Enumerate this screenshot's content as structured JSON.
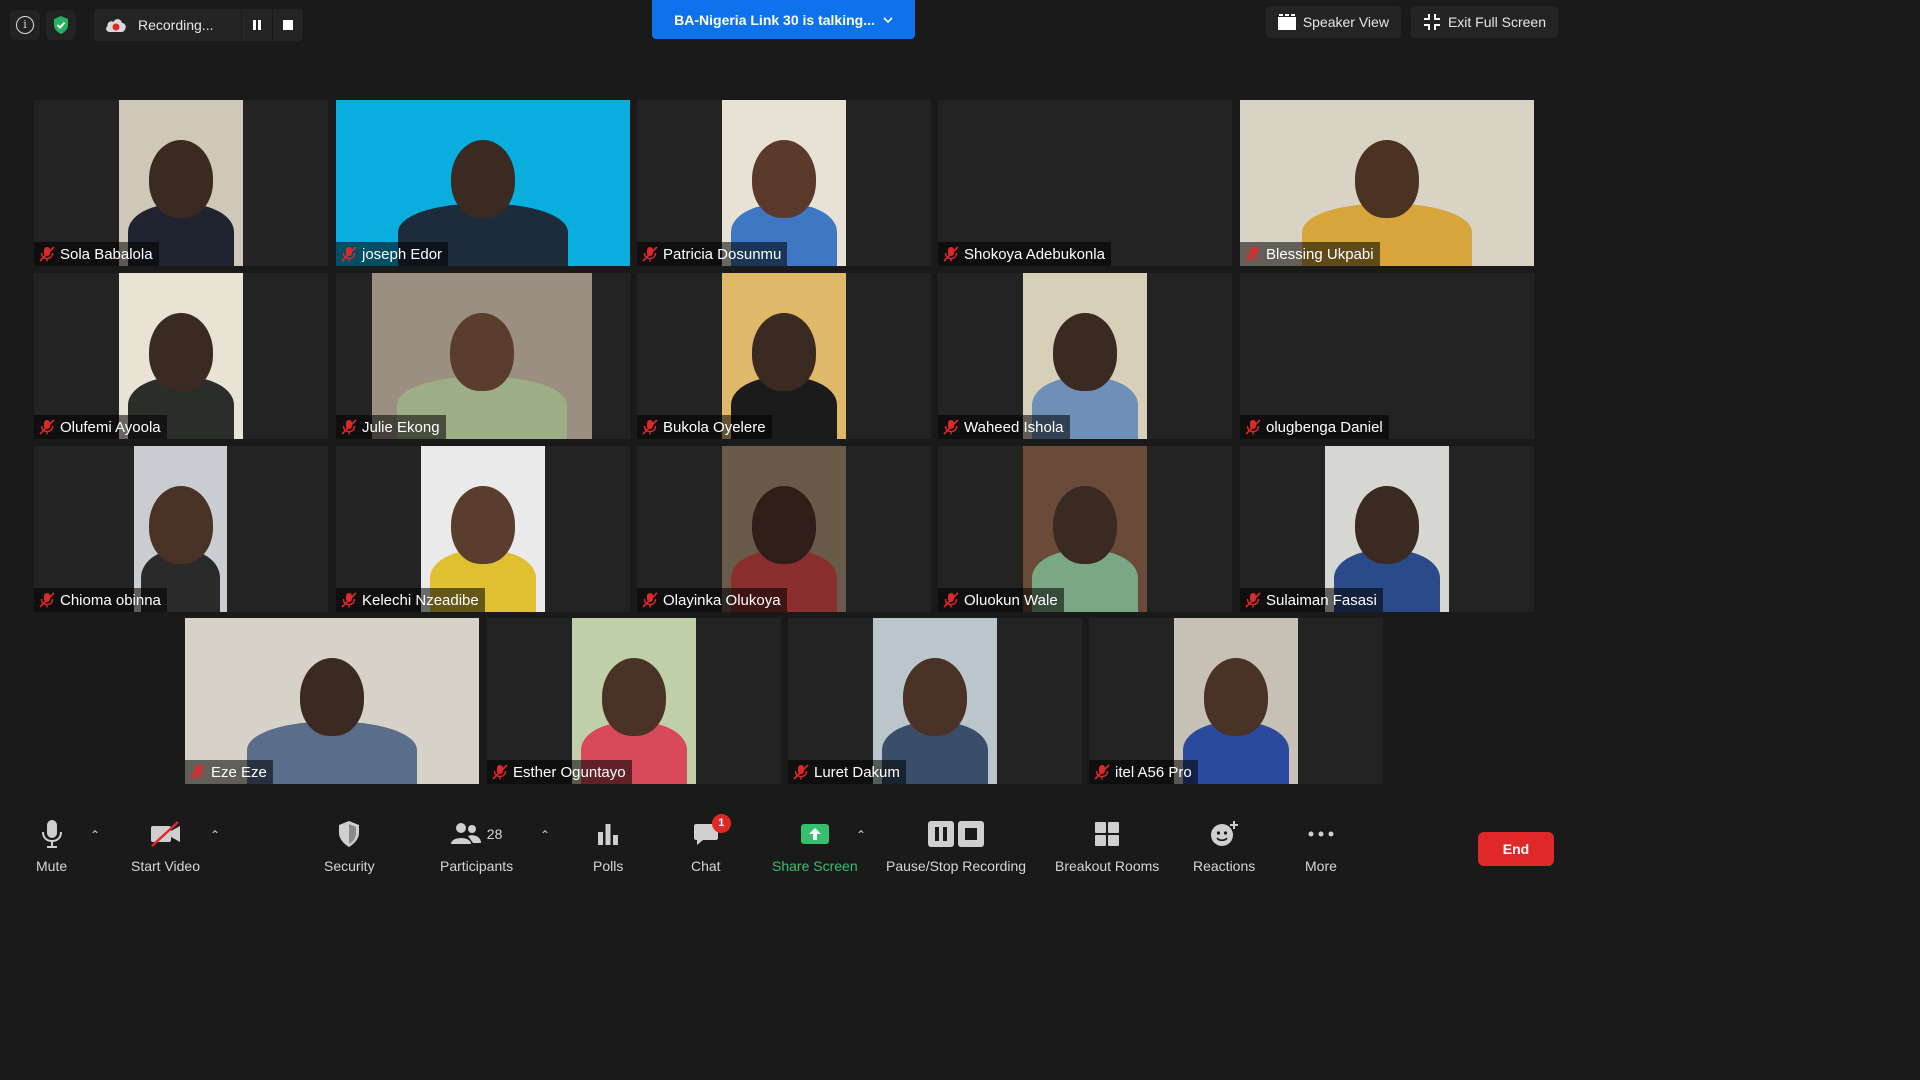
{
  "recording": {
    "label": "Recording..."
  },
  "talking": {
    "label": "BA-Nigeria Link 30 is talking..."
  },
  "top_right": {
    "speaker_view": "Speaker View",
    "exit_full_screen": "Exit Full Screen"
  },
  "participants": [
    {
      "name": "Sola Babalola"
    },
    {
      "name": "joseph Edor"
    },
    {
      "name": "Patricia Dosunmu"
    },
    {
      "name": "Shokoya Adebukonla"
    },
    {
      "name": "Blessing Ukpabi"
    },
    {
      "name": "Olufemi Ayoola"
    },
    {
      "name": "Julie Ekong"
    },
    {
      "name": "Bukola Oyelere"
    },
    {
      "name": "Waheed Ishola"
    },
    {
      "name": "olugbenga Daniel"
    },
    {
      "name": "Chioma obinna"
    },
    {
      "name": "Kelechi Nzeadibe"
    },
    {
      "name": "Olayinka Olukoya"
    },
    {
      "name": "Oluokun Wale"
    },
    {
      "name": "Sulaiman Fasasi"
    },
    {
      "name": "Eze Eze"
    },
    {
      "name": "Esther Oguntayo"
    },
    {
      "name": "Luret Dakum"
    },
    {
      "name": "itel A56 Pro"
    }
  ],
  "toolbar": {
    "mute": "Mute",
    "start_video": "Start Video",
    "security": "Security",
    "participants": "Participants",
    "participants_count": "28",
    "polls": "Polls",
    "chat": "Chat",
    "chat_badge": "1",
    "share_screen": "Share Screen",
    "pause_stop_recording": "Pause/Stop Recording",
    "breakout_rooms": "Breakout Rooms",
    "reactions": "Reactions",
    "more": "More",
    "end": "End"
  },
  "colors": {
    "accent": "#0e72ed",
    "end": "#e02828",
    "share": "#35c06d",
    "muted": "#e02828"
  }
}
